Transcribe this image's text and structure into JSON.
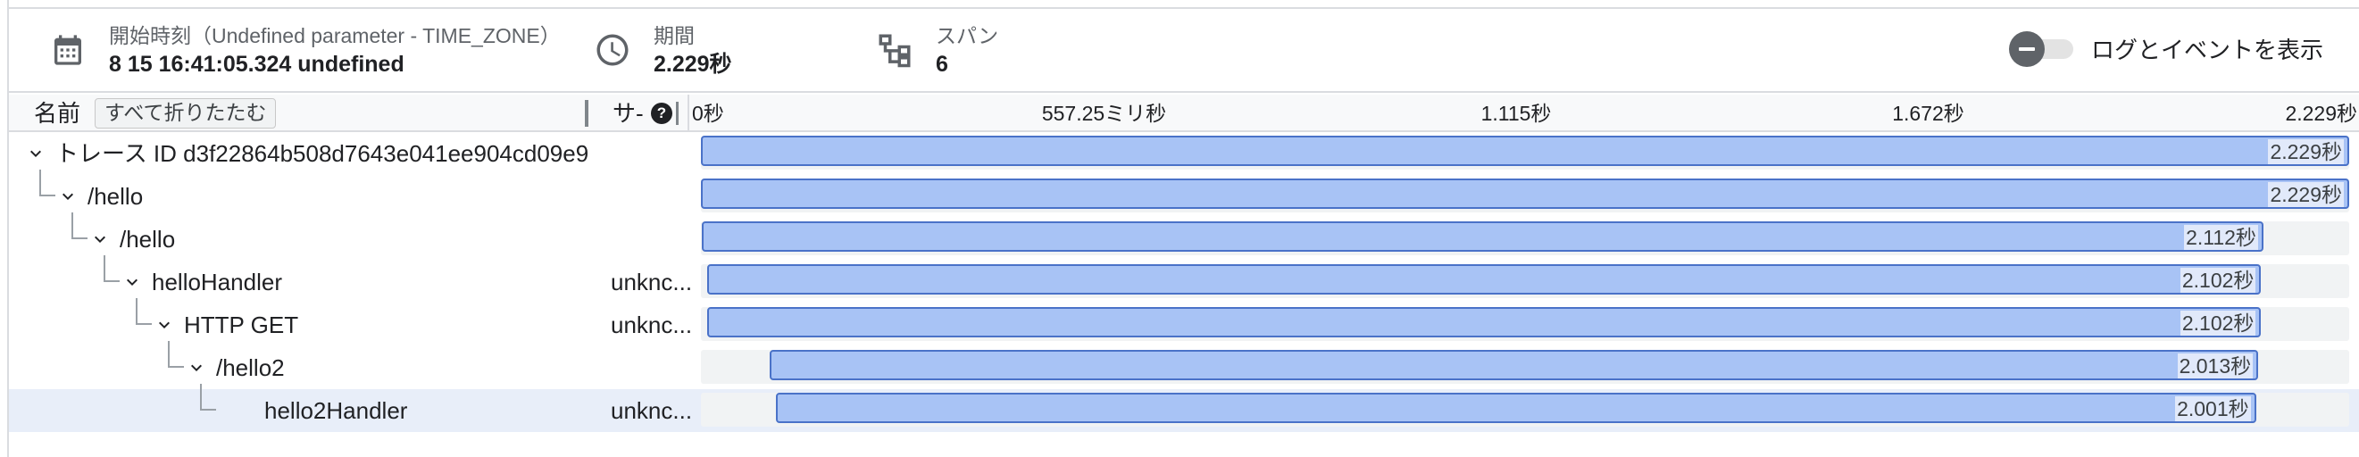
{
  "summary": {
    "start": {
      "icon": "calendar-icon",
      "label": "開始時刻（Undefined parameter - TIME_ZONE）",
      "value": "8 15 16:41:05.324 undefined"
    },
    "duration": {
      "icon": "clock-icon",
      "label": "期間",
      "value": "2.229秒"
    },
    "spans": {
      "icon": "span-tree-icon",
      "label": "スパン",
      "value": "6"
    },
    "toggle": {
      "label": "ログとイベントを表示",
      "checked": false
    }
  },
  "columns": {
    "name": "名前",
    "collapse_all": "すべて折りたたむ",
    "service": "サ-",
    "service_help_icon": "help-icon",
    "ticks": [
      "0秒",
      "557.25ミリ秒",
      "1.115秒",
      "1.672秒",
      "2.229秒"
    ]
  },
  "timeline": {
    "total_seconds": 2.229
  },
  "spans": [
    {
      "name": "トレース ID d3f22864b508d7643e041ee904cd09e9",
      "service": "",
      "depth": 0,
      "start": 0.0,
      "duration": 2.229,
      "duration_label": "2.229秒",
      "selected": false
    },
    {
      "name": "/hello",
      "service": "",
      "depth": 1,
      "start": 0.0,
      "duration": 2.229,
      "duration_label": "2.229秒",
      "selected": false
    },
    {
      "name": "/hello",
      "service": "",
      "depth": 2,
      "start": 0.001,
      "duration": 2.112,
      "duration_label": "2.112秒",
      "selected": false
    },
    {
      "name": "helloHandler",
      "service": "unknc...",
      "depth": 3,
      "start": 0.008,
      "duration": 2.102,
      "duration_label": "2.102秒",
      "selected": false
    },
    {
      "name": "HTTP GET",
      "service": "unknc...",
      "depth": 4,
      "start": 0.008,
      "duration": 2.102,
      "duration_label": "2.102秒",
      "selected": false
    },
    {
      "name": "/hello2",
      "service": "",
      "depth": 5,
      "start": 0.093,
      "duration": 2.013,
      "duration_label": "2.013秒",
      "selected": false
    },
    {
      "name": "hello2Handler",
      "service": "unknc...",
      "depth": 6,
      "start": 0.102,
      "duration": 2.001,
      "duration_label": "2.001秒",
      "selected": true
    }
  ],
  "colors": {
    "bar_fill": "#a8c3f5",
    "bar_border": "#4a72c8",
    "selected_row": "#e8eef9",
    "divider": "#dadce0"
  }
}
